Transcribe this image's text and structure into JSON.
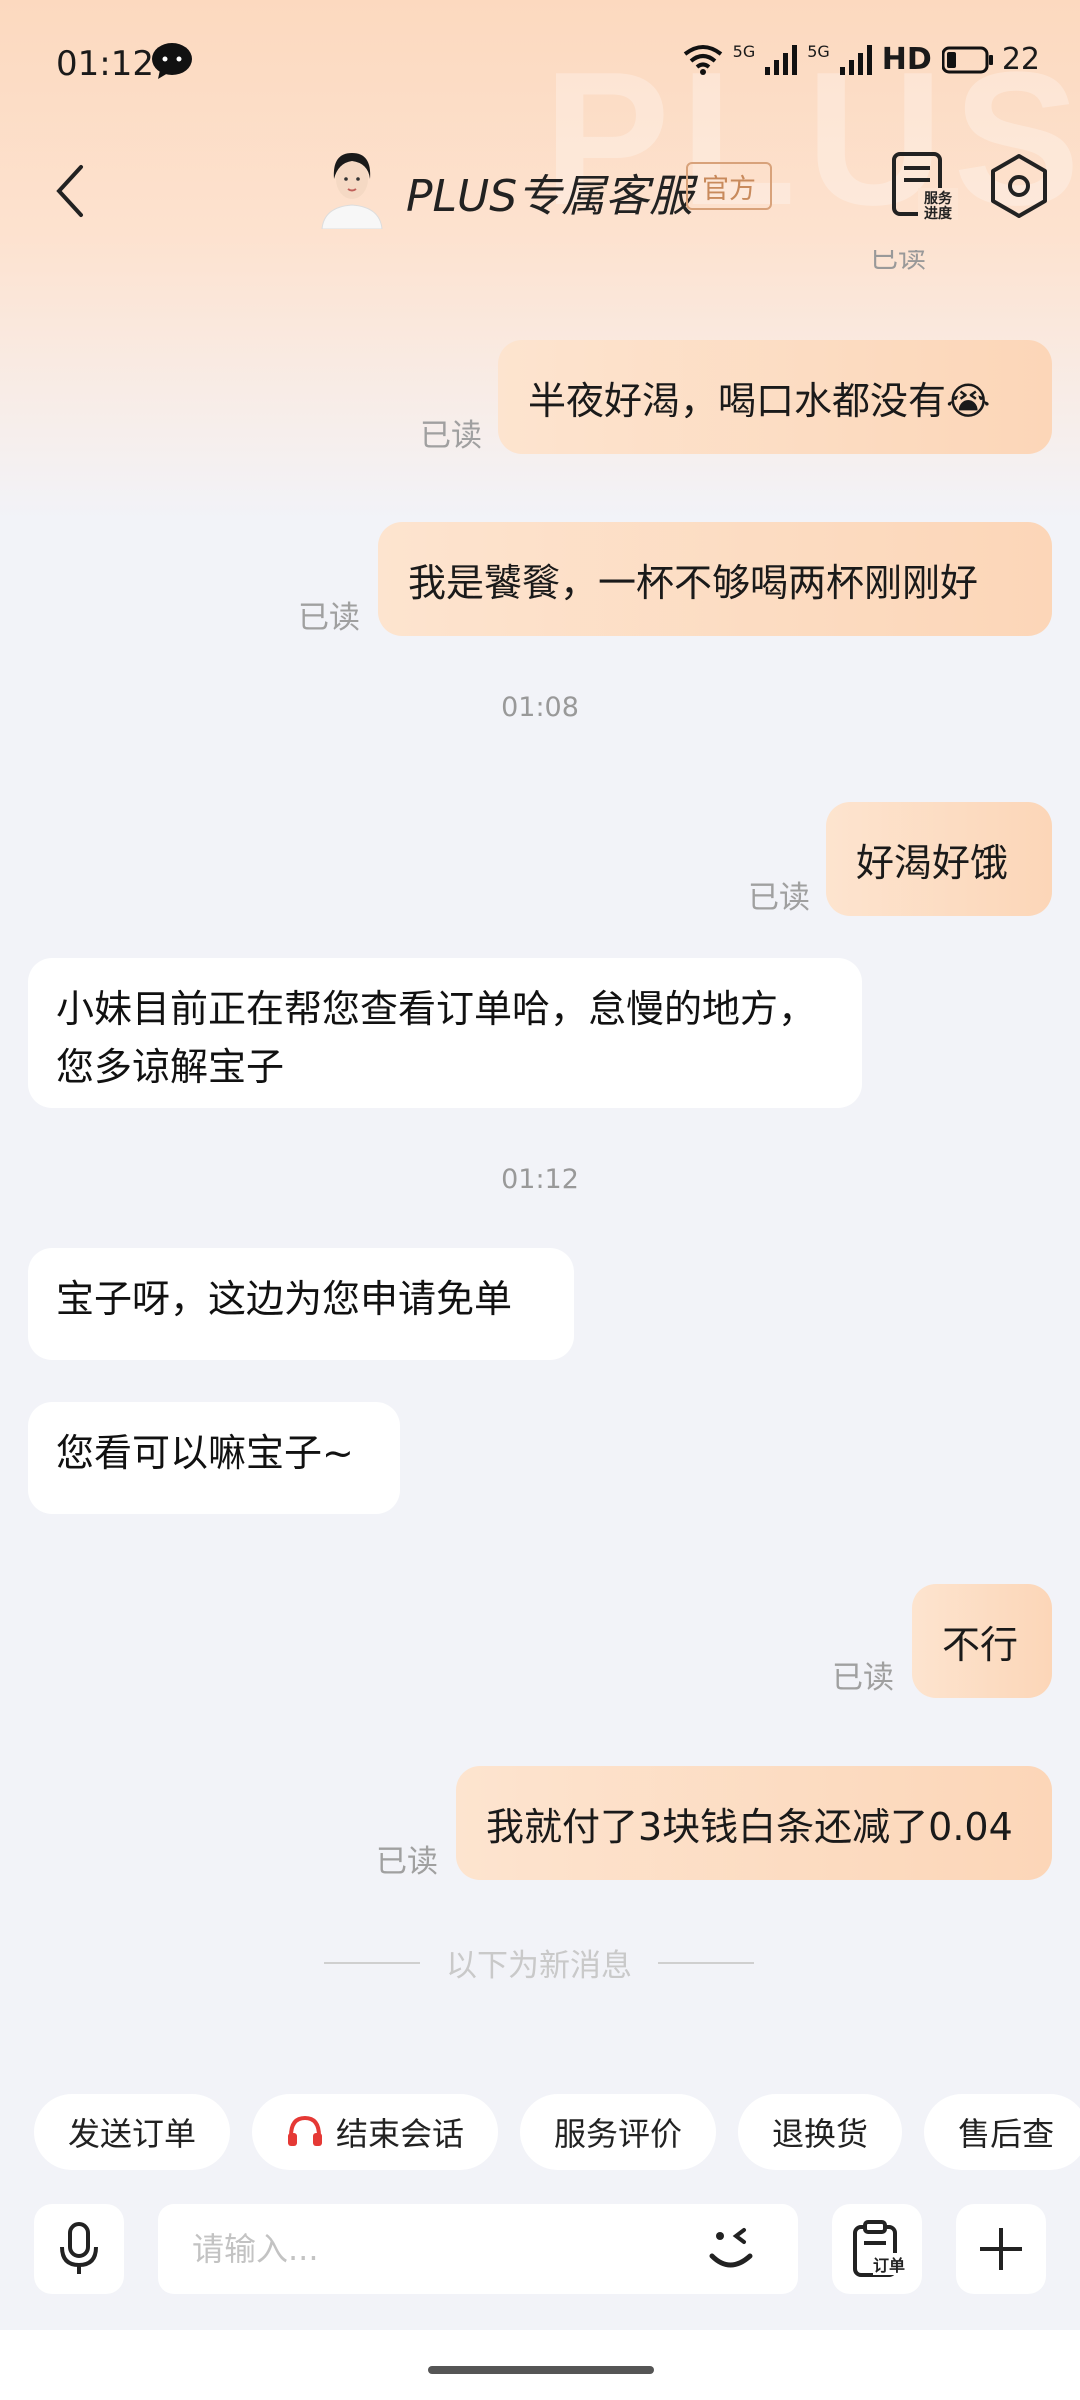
{
  "status_bar": {
    "time": "01:12",
    "network_1": "5G",
    "network_2": "5G",
    "hd_label": "HD",
    "battery": "22"
  },
  "header": {
    "title": "PLUS专属客服",
    "badge": "官方",
    "progress_label": "服务进度",
    "watermark": "PLUS"
  },
  "messages": {
    "cut_off_read": "已读",
    "m1": {
      "text": "半夜好渴，喝口水都没有😭",
      "read": "已读"
    },
    "m2": {
      "text": "我是饕餮，一杯不够喝两杯刚刚好",
      "read": "已读"
    },
    "ts1": "01:08",
    "m3": {
      "text": "好渴好饿",
      "read": "已读"
    },
    "m4": {
      "text": "小妹目前正在帮您查看订单哈，怠慢的地方，您多谅解宝子"
    },
    "ts2": "01:12",
    "m5": {
      "text": "宝子呀，这边为您申请免单"
    },
    "m6": {
      "text": "您看可以嘛宝子~"
    },
    "m7": {
      "text": "不行",
      "read": "已读"
    },
    "m8": {
      "text": "我就付了3块钱白条还减了0.04",
      "read": "已读"
    },
    "new_divider": "以下为新消息"
  },
  "quick_actions": [
    "发送订单",
    "结束会话",
    "服务评价",
    "退换货",
    "售后查"
  ],
  "input": {
    "placeholder": "请输入...",
    "order_label": "订单"
  },
  "colors": {
    "accent_orange": "#fcd6b8",
    "headset_red": "#e53935"
  }
}
